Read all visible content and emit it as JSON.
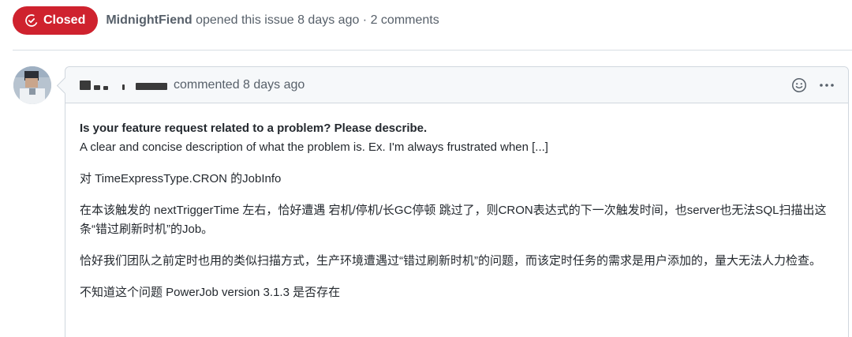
{
  "issue": {
    "state_label": "Closed",
    "state_color": "#cf222e",
    "author": "MidnightFiend",
    "meta_text": " opened this issue 8 days ago · 2 comments"
  },
  "comment": {
    "meta_text": "commented 8 days ago",
    "actions": {
      "emoji_icon": "smiley-icon",
      "more_icon": "kebab-horizontal-icon"
    },
    "paragraphs": [
      {
        "lead": "Is your feature request related to a problem? Please describe.",
        "text": "A clear and concise description of what the problem is. Ex. I'm always frustrated when [...]"
      },
      {
        "text": "对 TimeExpressType.CRON 的JobInfo"
      },
      {
        "text": "在本该触发的 nextTriggerTime 左右，恰好遭遇 宕机/停机/长GC停顿 跳过了，则CRON表达式的下一次触发时间，也server也无法SQL扫描出这条“错过刷新时机”的Job。"
      },
      {
        "text": "恰好我们团队之前定时也用的类似扫描方式，生产环境遭遇过“错过刷新时机”的问题，而该定时任务的需求是用户添加的，量大无法人力检查。"
      },
      {
        "text": "不知道这个问题 PowerJob version 3.1.3 是否存在"
      }
    ]
  }
}
